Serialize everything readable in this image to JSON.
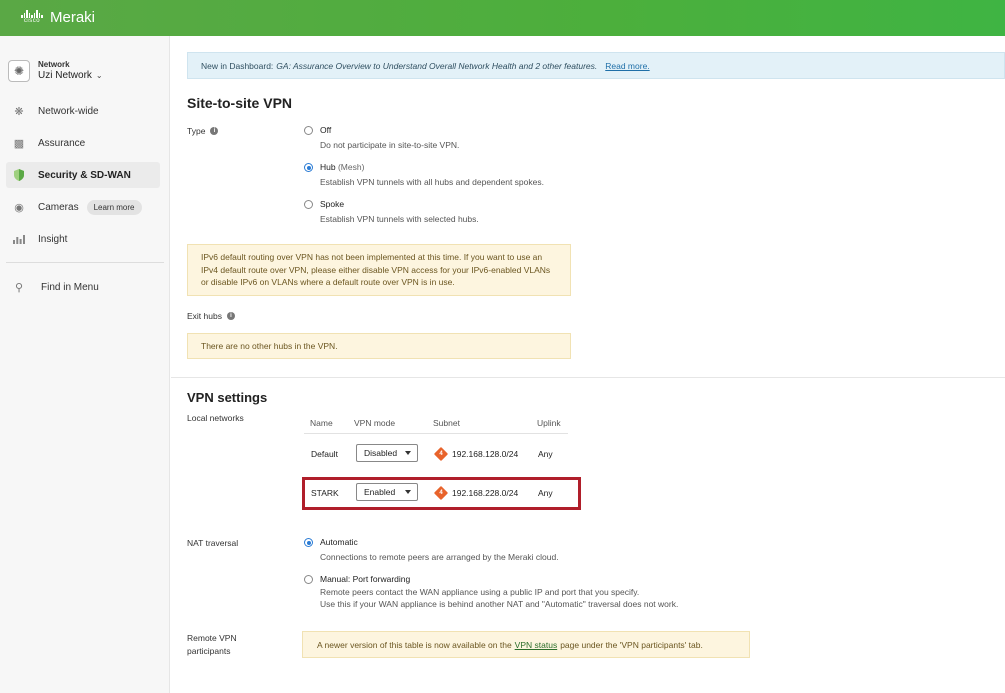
{
  "brand": {
    "cisco": "cisco",
    "product": "Meraki"
  },
  "sidebar": {
    "network_label": "Network",
    "network_name": "Uzi Network",
    "items": [
      {
        "label": "Network-wide",
        "icon": "network-wide-icon"
      },
      {
        "label": "Assurance",
        "icon": "assurance-icon"
      },
      {
        "label": "Security & SD-WAN",
        "icon": "shield-icon"
      },
      {
        "label": "Cameras",
        "icon": "camera-icon",
        "badge": "Learn more"
      },
      {
        "label": "Insight",
        "icon": "bar-chart-icon"
      },
      {
        "label": "Find in Menu",
        "icon": "find-menu-icon"
      }
    ]
  },
  "banner": {
    "prefix": "New in Dashboard:",
    "text": "GA: Assurance Overview to Understand Overall Network Health and 2 other features.",
    "link": "Read more."
  },
  "site_to_site": {
    "title": "Site-to-site VPN",
    "type_label": "Type",
    "options": [
      {
        "title": "Off",
        "sub": "",
        "desc": "Do not participate in site-to-site VPN.",
        "checked": false
      },
      {
        "title": "Hub",
        "sub": "(Mesh)",
        "desc": "Establish VPN tunnels with all hubs and dependent spokes.",
        "checked": true
      },
      {
        "title": "Spoke",
        "sub": "",
        "desc": "Establish VPN tunnels with selected hubs.",
        "checked": false
      }
    ],
    "ipv6_warning": "IPv6 default routing over VPN has not been implemented at this time. If you want to use an IPv4 default route over VPN, please either disable VPN access for your IPv6-enabled VLANs or disable IPv6 on VLANs where a default route over VPN is in use.",
    "exit_hubs_label": "Exit hubs",
    "exit_hubs_notice": "There are no other hubs in the VPN."
  },
  "vpn_settings": {
    "title": "VPN settings",
    "local_networks_label": "Local networks",
    "columns": [
      "Name",
      "VPN mode",
      "Subnet",
      "Uplink"
    ],
    "rows": [
      {
        "name": "Default",
        "mode": "Disabled",
        "ip_badge": "4",
        "subnet": "192.168.128.0/24",
        "uplink": "Any"
      },
      {
        "name": "STARK",
        "mode": "Enabled",
        "ip_badge": "4",
        "subnet": "192.168.228.0/24",
        "uplink": "Any"
      }
    ],
    "nat_label": "NAT traversal",
    "nat_options": [
      {
        "title": "Automatic",
        "desc1": "Connections to remote peers are arranged by the Meraki cloud.",
        "desc2": "",
        "checked": true
      },
      {
        "title": "Manual: Port forwarding",
        "desc1": "Remote peers contact the WAN appliance using a public IP and port that you specify.",
        "desc2": "Use this if your WAN appliance is behind another NAT and \"Automatic\" traversal does not work.",
        "checked": false
      }
    ],
    "remote_label_1": "Remote VPN",
    "remote_label_2": "participants",
    "remote_note_before": "A newer version of this table is now available on the",
    "remote_note_link": "VPN status",
    "remote_note_after": "page under the 'VPN participants' tab."
  },
  "colors": {
    "topbar": "#4caf3c",
    "highlight": "#b01e2a",
    "accent": "#2a7bd4",
    "ipv4_badge": "#e8632b"
  }
}
